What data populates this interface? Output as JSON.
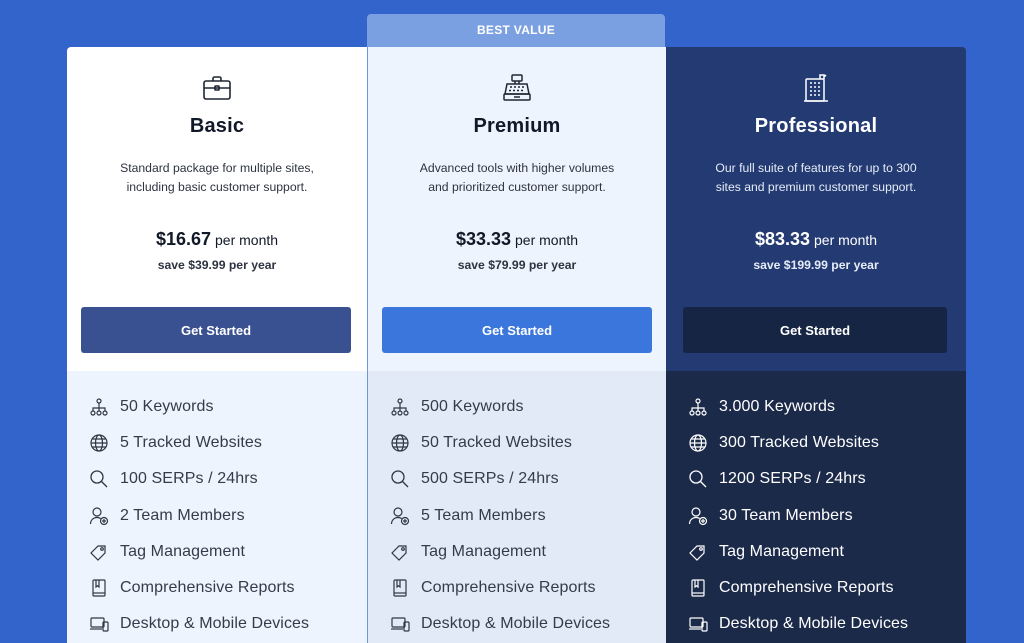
{
  "badge": {
    "label": "BEST VALUE"
  },
  "plans": [
    {
      "id": "basic",
      "icon": "briefcase-icon",
      "name": "Basic",
      "description": "Standard package for multiple sites, including basic customer support.",
      "price": "$16.67",
      "price_period": "per month",
      "savings": "save $39.99 per year",
      "cta_label": "Get Started",
      "features": [
        {
          "icon": "sitemap-icon",
          "label": "50 Keywords"
        },
        {
          "icon": "globe-icon",
          "label": "5 Tracked Websites"
        },
        {
          "icon": "search-icon",
          "label": "100 SERPs / 24hrs"
        },
        {
          "icon": "add-user-icon",
          "label": "2 Team Members"
        },
        {
          "icon": "tag-icon",
          "label": "Tag Management"
        },
        {
          "icon": "book-icon",
          "label": "Comprehensive Reports"
        },
        {
          "icon": "devices-icon",
          "label": "Desktop & Mobile Devices"
        }
      ]
    },
    {
      "id": "premium",
      "icon": "cash-register-icon",
      "name": "Premium",
      "description": "Advanced tools with higher volumes and prioritized customer support.",
      "price": "$33.33",
      "price_period": "per month",
      "savings": "save $79.99 per year",
      "cta_label": "Get Started",
      "features": [
        {
          "icon": "sitemap-icon",
          "label": "500 Keywords"
        },
        {
          "icon": "globe-icon",
          "label": "50 Tracked Websites"
        },
        {
          "icon": "search-icon",
          "label": "500 SERPs / 24hrs"
        },
        {
          "icon": "add-user-icon",
          "label": "5 Team Members"
        },
        {
          "icon": "tag-icon",
          "label": "Tag Management"
        },
        {
          "icon": "book-icon",
          "label": "Comprehensive Reports"
        },
        {
          "icon": "devices-icon",
          "label": "Desktop & Mobile Devices"
        }
      ]
    },
    {
      "id": "professional",
      "icon": "building-icon",
      "name": "Professional",
      "description": "Our full suite of features for up to 300 sites and premium customer support.",
      "price": "$83.33",
      "price_period": "per month",
      "savings": "save $199.99 per year",
      "cta_label": "Get Started",
      "features": [
        {
          "icon": "sitemap-icon",
          "label": "3.000 Keywords"
        },
        {
          "icon": "globe-icon",
          "label": "300 Tracked Websites"
        },
        {
          "icon": "search-icon",
          "label": "1200 SERPs / 24hrs"
        },
        {
          "icon": "add-user-icon",
          "label": "30 Team Members"
        },
        {
          "icon": "tag-icon",
          "label": "Tag Management"
        },
        {
          "icon": "book-icon",
          "label": "Comprehensive Reports"
        },
        {
          "icon": "devices-icon",
          "label": "Desktop & Mobile Devices"
        }
      ]
    }
  ],
  "colors": {
    "page_background": "#3264cb",
    "badge_background": "#7aa0e2",
    "basic_button": "#3a5191",
    "premium_button": "#3b76dc",
    "professional_panel": "#233a72",
    "professional_button": "#172544",
    "professional_features": "#1c2a4a"
  }
}
